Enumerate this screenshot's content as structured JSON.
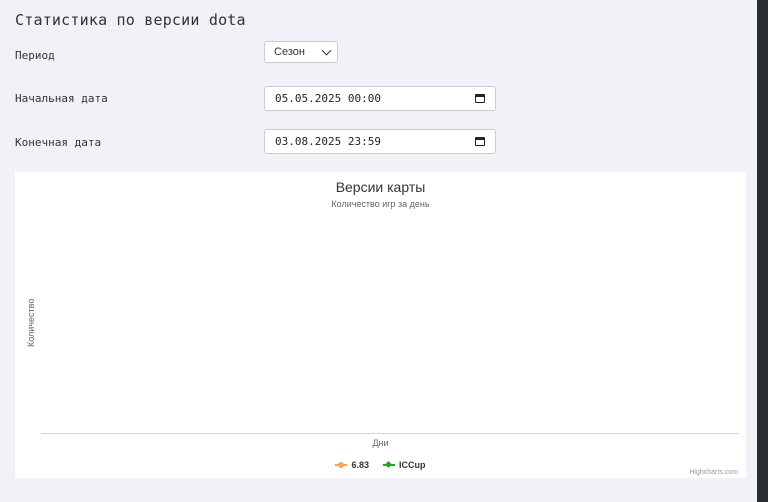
{
  "page": {
    "title": "Статистика по версии dota"
  },
  "form": {
    "period": {
      "label": "Период",
      "value": "Сезон"
    },
    "start_date": {
      "label": "Начальная дата",
      "value": "05.05.2025 00:00"
    },
    "end_date": {
      "label": "Конечная дата",
      "value": "03.08.2025 23:59"
    }
  },
  "chart_data": {
    "type": "line",
    "title": "Версии карты",
    "subtitle": "Количество игр за день",
    "xlabel": "Дни",
    "ylabel": "Количество",
    "categories": [],
    "series": [
      {
        "name": "6.83",
        "color": "#f7a35c",
        "values": []
      },
      {
        "name": "ICCup",
        "color": "#2ca02c",
        "values": []
      }
    ],
    "legend": "bottom-center",
    "grid": false,
    "credits": "Highcharts.com"
  }
}
